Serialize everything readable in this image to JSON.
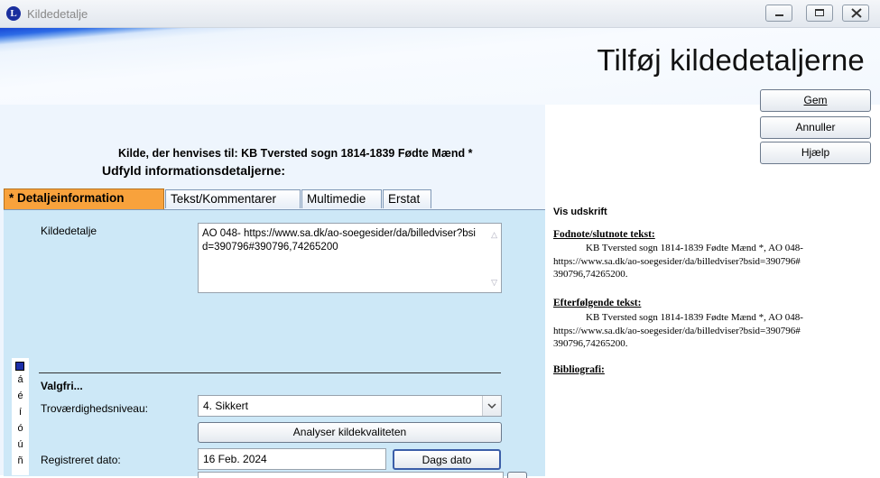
{
  "window": {
    "icon_letter": "L",
    "title": "Kildedetalje"
  },
  "header": {
    "title": "Tilføj kildedetaljerne"
  },
  "buttons": {
    "save": "Gem",
    "cancel": "Annuller",
    "help": "Hjælp"
  },
  "source_line": "Kilde, der henvises til: KB Tversted sogn 1814-1839 Fødte Mænd *",
  "subtitle": "Udfyld informationsdetaljerne:",
  "tabs": [
    {
      "label": "* Detaljeinformation",
      "active": true
    },
    {
      "label": "Tekst/Kommentarer",
      "active": false
    },
    {
      "label": "Multimedie",
      "active": false
    },
    {
      "label": "Erstat",
      "active": false
    }
  ],
  "form": {
    "detail_label": "Kildedetalje",
    "detail_value": "AO 048- https://www.sa.dk/ao-soegesider/da/billedviser?bsid=390796#390796,74265200",
    "optional_heading": "Valgfri...",
    "reliability_label": "Troværdighedsniveau:",
    "reliability_value": "4.  Sikkert",
    "analyze_button": "Analyser kildekvaliteten",
    "registered_label": "Registreret dato:",
    "registered_value": "16 Feb. 2024",
    "today_button": "Dags dato"
  },
  "char_strip": [
    "á",
    "é",
    "í",
    "ó",
    "ú",
    "ñ"
  ],
  "preview": {
    "heading": "Vis udskrift",
    "footnote_heading": "Fodnote/slutnote tekst:",
    "footnote_text": "KB Tversted sogn 1814-1839 Fødte Mænd *, AO 048- https://www.sa.dk/ao-soegesider/da/billedviser?bsid=390796# 390796,74265200.",
    "subsequent_heading": "Efterfølgende tekst:",
    "subsequent_text": "KB Tversted sogn 1814-1839 Fødte Mænd *, AO 048- https://www.sa.dk/ao-soegesider/da/billedviser?bsid=390796# 390796,74265200.",
    "bibliography_heading": "Bibliografi:"
  },
  "colors": {
    "active_tab": "#f8a23c",
    "panel": "#cde8f7",
    "banner_blue": "#1747d6"
  }
}
